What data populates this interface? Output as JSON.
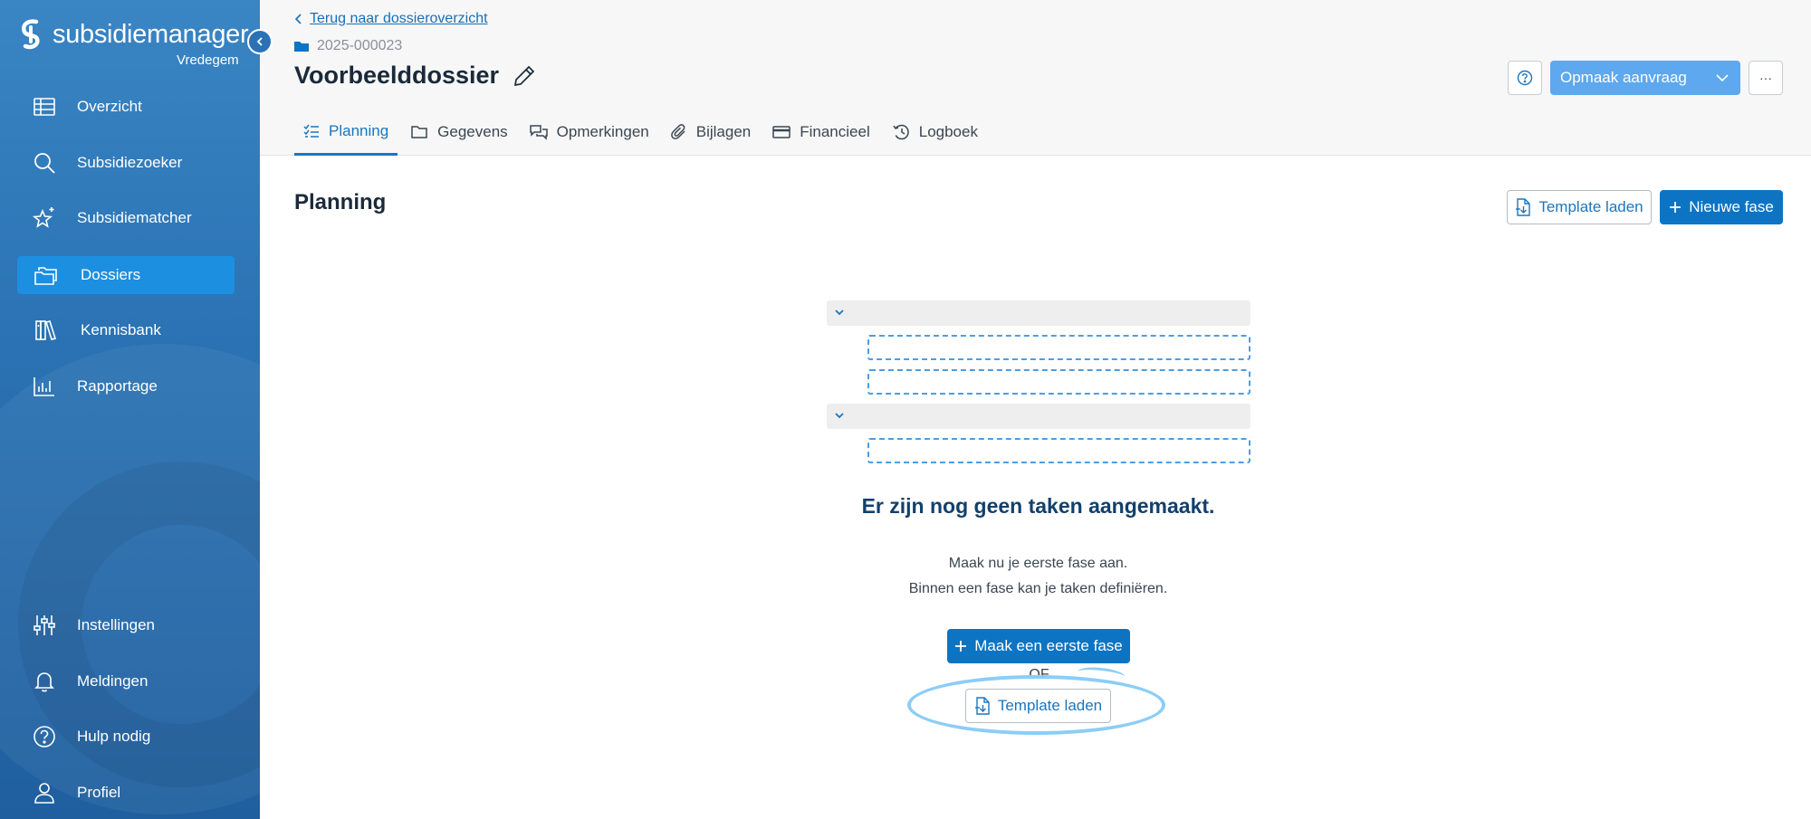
{
  "brand": {
    "name": "subsidiemanager",
    "subtitle": "Vredegem"
  },
  "sidebar": {
    "top_items": [
      {
        "label": "Overzicht",
        "icon": "table-icon"
      },
      {
        "label": "Subsidiezoeker",
        "icon": "search-icon"
      },
      {
        "label": "Subsidiematcher",
        "icon": "sparkle-star-icon"
      },
      {
        "label": "Dossiers",
        "icon": "folders-icon",
        "active": true
      },
      {
        "label": "Kennisbank",
        "icon": "books-icon"
      },
      {
        "label": "Rapportage",
        "icon": "bar-chart-icon"
      }
    ],
    "bottom_items": [
      {
        "label": "Instellingen",
        "icon": "sliders-icon"
      },
      {
        "label": "Meldingen",
        "icon": "bell-icon"
      },
      {
        "label": "Hulp nodig",
        "icon": "help-circle-icon"
      },
      {
        "label": "Profiel",
        "icon": "user-icon"
      }
    ]
  },
  "header": {
    "back_label": "Terug naar dossieroverzicht",
    "dossier_id": "2025-000023",
    "title": "Voorbeelddossier",
    "tabs": [
      {
        "label": "Planning",
        "icon": "checklist-icon",
        "active": true
      },
      {
        "label": "Gegevens",
        "icon": "folder-icon"
      },
      {
        "label": "Opmerkingen",
        "icon": "comments-icon"
      },
      {
        "label": "Bijlagen",
        "icon": "paperclip-icon"
      },
      {
        "label": "Financieel",
        "icon": "credit-card-icon"
      },
      {
        "label": "Logboek",
        "icon": "history-icon"
      }
    ],
    "action_label": "Opmaak aanvraag",
    "more_label": "···"
  },
  "main": {
    "section_title": "Planning",
    "template_button": "Template laden",
    "new_phase_button": "Nieuwe fase",
    "empty_title": "Er zijn nog geen taken aangemaakt.",
    "empty_line1": "Maak nu je eerste fase aan.",
    "empty_line2": "Binnen een fase kan je taken definiëren.",
    "first_phase_button": "Maak een eerste fase",
    "or_label": "OF",
    "template_button_center": "Template laden"
  },
  "colors": {
    "primary": "#0c74c3",
    "sidebar": "#2b73b4",
    "active_nav": "#1d8fe1",
    "action_light": "#5da8ee",
    "highlight": "#8ccdf6"
  }
}
